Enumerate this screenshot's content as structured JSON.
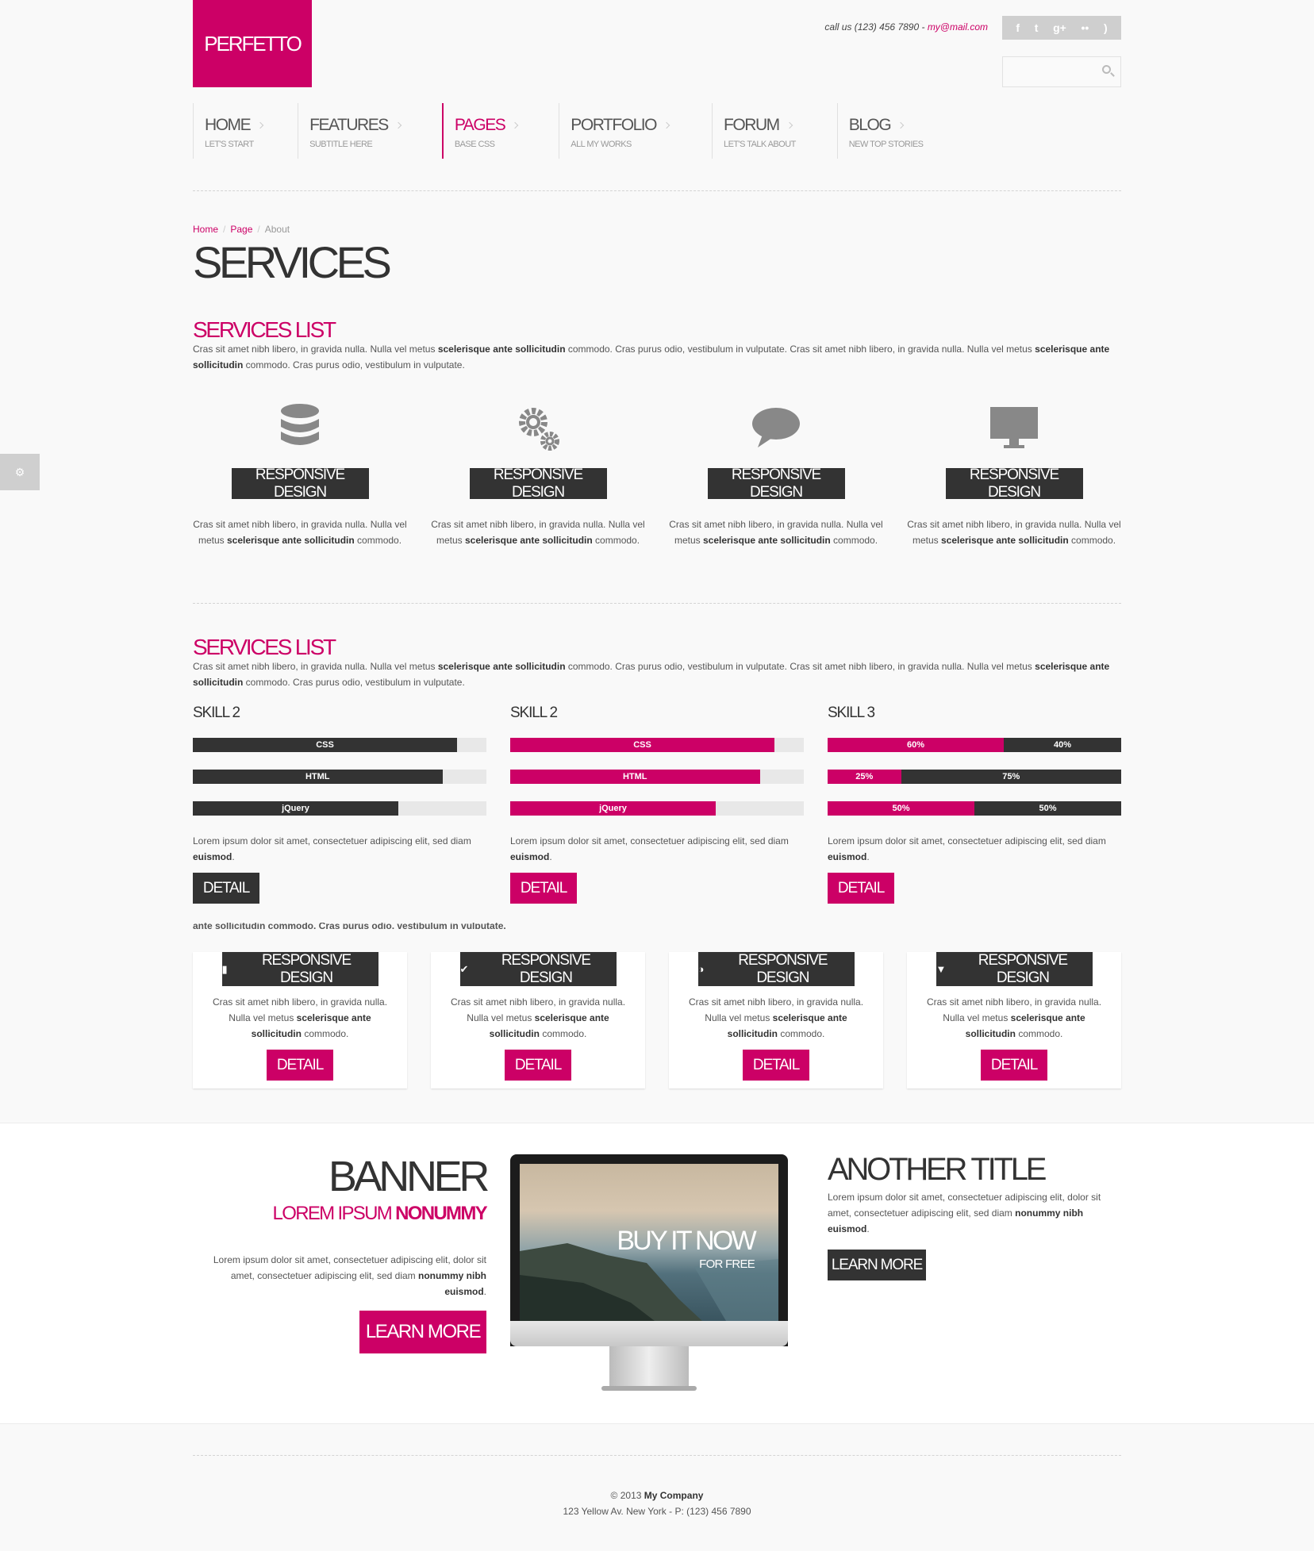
{
  "brand": {
    "logo": "PERFETTO",
    "accent": "#cc0066"
  },
  "header": {
    "call_label": "call us (123) 456 7890 - ",
    "email": "my@mail.com",
    "social": [
      "facebook-icon",
      "twitter-icon",
      "google-plus-icon",
      "flickr-icon",
      "rss-icon"
    ],
    "search_placeholder": ""
  },
  "nav": [
    {
      "label": "HOME",
      "sub": "LET'S START"
    },
    {
      "label": "FEATURES",
      "sub": "SUBTITLE HERE"
    },
    {
      "label": "PAGES",
      "sub": "BASE CSS",
      "active": true
    },
    {
      "label": "PORTFOLIO",
      "sub": "ALL MY WORKS"
    },
    {
      "label": "FORUM",
      "sub": "LET'S TALK ABOUT"
    },
    {
      "label": "BLOG",
      "sub": "NEW TOP STORIES"
    }
  ],
  "breadcrumb": [
    "Home",
    "Page",
    "About"
  ],
  "page_title": "SERVICES",
  "section1": {
    "title": "SERVICES LIST",
    "text_a": "Cras sit amet nibh libero, in gravida nulla. Nulla vel metus ",
    "bold_a": "scelerisque ante sollicitudin",
    "text_b": " commodo. Cras purus odio, vestibulum in vulputate. Cras sit amet nibh libero, in gravida nulla. Nulla vel metus ",
    "bold_b": "scelerisque ante sollicitudin",
    "text_c": " commodo. Cras purus odio, vestibulum in vulputate.",
    "services": [
      {
        "icon": "database-icon",
        "label": "RESPONSIVE DESIGN"
      },
      {
        "icon": "gears-icon",
        "label": "RESPONSIVE DESIGN"
      },
      {
        "icon": "chat-bubble-icon",
        "label": "RESPONSIVE DESIGN"
      },
      {
        "icon": "monitor-icon",
        "label": "RESPONSIVE DESIGN"
      }
    ],
    "service_text_a": "Cras sit amet nibh libero, in gravida nulla. Nulla vel metus ",
    "service_bold": "scelerisque ante sollicitudin",
    "service_text_b": " commodo."
  },
  "section2": {
    "title": "SERVICES LIST",
    "skills": [
      {
        "title": "SKILL 2",
        "bars": [
          {
            "label": "CSS",
            "value": 0.9
          },
          {
            "label": "HTML",
            "value": 0.85
          },
          {
            "label": "jQuery",
            "value": 0.7
          }
        ],
        "color": "#333333"
      },
      {
        "title": "SKILL 2",
        "bars": [
          {
            "label": "CSS",
            "value": 0.9
          },
          {
            "label": "HTML",
            "value": 0.85
          },
          {
            "label": "jQuery",
            "value": 0.7
          }
        ],
        "color": "#cc0066"
      },
      {
        "title": "SKILL 3",
        "bars": [
          {
            "a": "60%",
            "b": "40%",
            "value": 0.6
          },
          {
            "a": "25%",
            "b": "75%",
            "value": 0.25
          },
          {
            "a": "50%",
            "b": "50%",
            "value": 0.5
          }
        ],
        "color": "#cc0066"
      }
    ],
    "skill_text": "Lorem ipsum dolor sit amet, consectetuer adipiscing elit, sed diam ",
    "skill_bold": "euismod",
    "detail": "DETAIL",
    "overlap_text": "ante sollicitudin commodo. Cras purus odio, vestibulum in vulputate."
  },
  "cards": [
    {
      "icon": "bookmark-icon",
      "label": "RESPONSIVE DESIGN"
    },
    {
      "icon": "check-circle-icon",
      "label": "RESPONSIVE DESIGN"
    },
    {
      "icon": "half-circle-icon",
      "label": "RESPONSIVE DESIGN"
    },
    {
      "icon": "filter-icon",
      "label": "RESPONSIVE DESIGN"
    }
  ],
  "card_text_a": "Cras sit amet nibh libero, in gravida nulla. Nulla vel metus ",
  "card_bold": "scelerisque ante sollicitudin",
  "card_text_b": " commodo.",
  "banner": {
    "title": "BANNER",
    "sub_a": "LOREM IPSUM ",
    "sub_b": "NONUMMY",
    "text_a": "Lorem ipsum dolor sit amet, consectetuer adipiscing elit, dolor sit amet, consectetuer adipiscing elit, sed diam ",
    "bold": "nonummy nibh euismod",
    "text_b": ".",
    "button": "LEARN MORE",
    "screen_title": "BUY IT NOW",
    "screen_sub": "FOR FREE"
  },
  "another": {
    "title": "ANOTHER TITLE",
    "text_a": "Lorem ipsum dolor sit amet, consectetuer adipiscing elit, dolor sit amet, consectetuer adipiscing elit, sed diam ",
    "bold": "nonummy nibh euismod",
    "text_b": ".",
    "button": "LEARN MORE"
  },
  "footer": {
    "copy_a": "© 2013 ",
    "company": "My Company",
    "address": "123 Yellow Av. New York - P: (123) 456 7890"
  }
}
